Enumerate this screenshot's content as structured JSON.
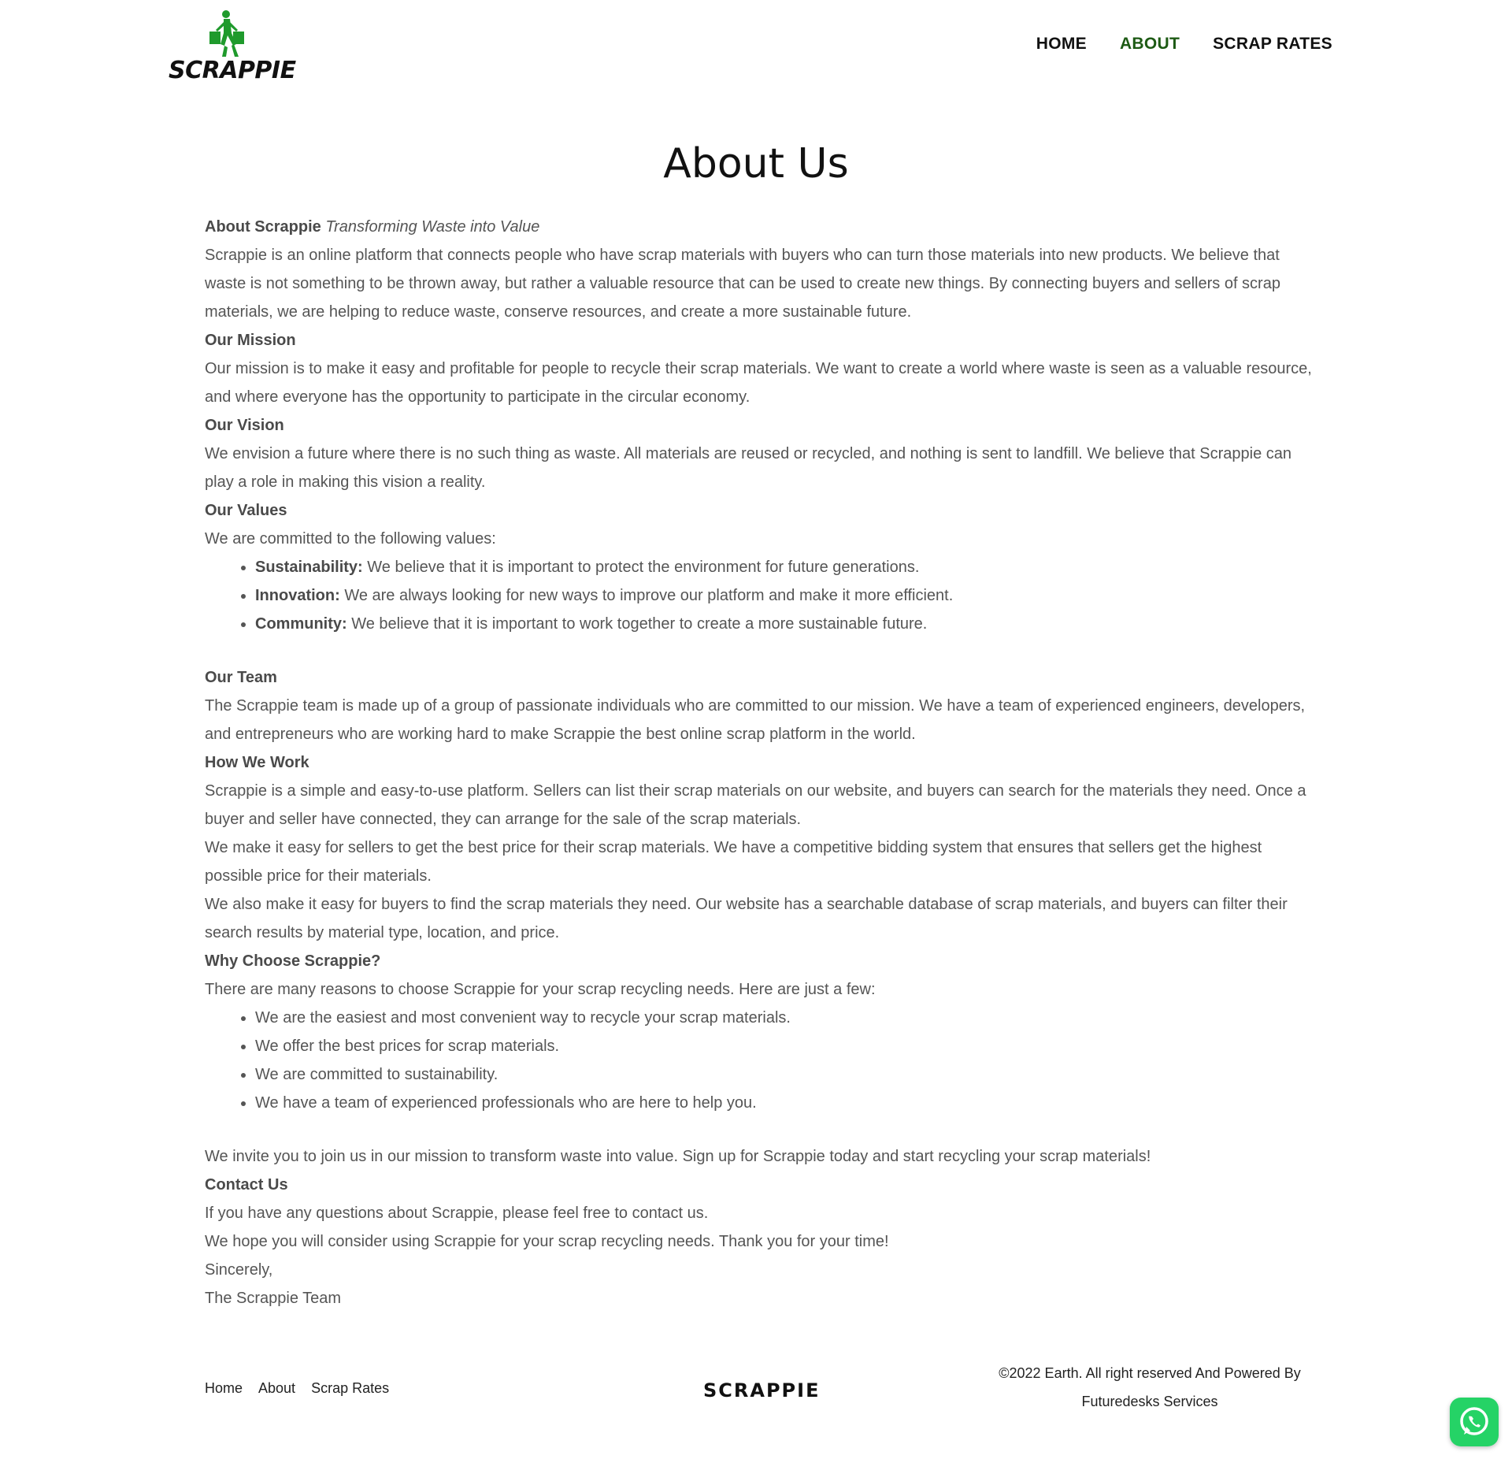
{
  "header": {
    "logo_text": "SCRAPPIE",
    "nav": [
      {
        "label": "HOME",
        "active": false
      },
      {
        "label": "ABOUT",
        "active": true
      },
      {
        "label": "SCRAP RATES",
        "active": false
      }
    ],
    "active_color": "#1d5a14"
  },
  "page": {
    "title": "About Us"
  },
  "content": {
    "intro_heading": "About Scrappie",
    "intro_tagline": "Transforming Waste into Value",
    "intro_text": "Scrappie is an online platform that connects people who have scrap materials with buyers who can turn those materials into new products. We believe that waste is not something to be thrown away, but rather a valuable resource that can be used to create new things. By connecting buyers and sellers of scrap materials, we are helping to reduce waste, conserve resources, and create a more sustainable future.",
    "mission_heading": "Our Mission",
    "mission_text": "Our mission is to make it easy and profitable for people to recycle their scrap materials. We want to create a world where waste is seen as a valuable resource, and where everyone has the opportunity to participate in the circular economy.",
    "vision_heading": "Our Vision",
    "vision_text": "We envision a future where there is no such thing as waste. All materials are reused or recycled, and nothing is sent to landfill. We believe that Scrappie can play a role in making this vision a reality.",
    "values_heading": "Our Values",
    "values_intro": "We are committed to the following values:",
    "values": [
      {
        "term": "Sustainability:",
        "text": " We believe that it is important to protect the environment for future generations."
      },
      {
        "term": "Innovation:",
        "text": " We are always looking for new ways to improve our platform and make it more efficient."
      },
      {
        "term": "Community:",
        "text": " We believe that it is important to work together to create a more sustainable future."
      }
    ],
    "team_heading": "Our Team",
    "team_text": "The Scrappie team is made up of a group of passionate individuals who are committed to our mission. We have a team of experienced engineers, developers, and entrepreneurs who are working hard to make Scrappie the best online scrap platform in the world.",
    "how_heading": "How We Work",
    "how_text_1": "Scrappie is a simple and easy-to-use platform. Sellers can list their scrap materials on our website, and buyers can search for the materials they need. Once a buyer and seller have connected, they can arrange for the sale of the scrap materials.",
    "how_text_2": "We make it easy for sellers to get the best price for their scrap materials. We have a competitive bidding system that ensures that sellers get the highest possible price for their materials.",
    "how_text_3": "We also make it easy for buyers to find the scrap materials they need. Our website has a searchable database of scrap materials, and buyers can filter their search results by material type, location, and price.",
    "why_heading": "Why Choose Scrappie?",
    "why_intro": "There are many reasons to choose Scrappie for your scrap recycling needs. Here are just a few:",
    "why_items": [
      "We are the easiest and most convenient way to recycle your scrap materials.",
      "We offer the best prices for scrap materials.",
      "We are committed to sustainability.",
      "We have a team of experienced professionals who are here to help you."
    ],
    "invite_text": "We invite you to join us in our mission to transform waste into value. Sign up for Scrappie today and start recycling your scrap materials!",
    "contact_heading": "Contact Us",
    "contact_text": "If you have any questions about Scrappie, please feel free to contact us.",
    "closing_text": "We hope you will consider using Scrappie for your scrap recycling needs. Thank you for your time!",
    "signoff": "Sincerely,",
    "signature": "The Scrappie Team"
  },
  "footer": {
    "links": [
      "Home",
      "About",
      "Scrap Rates"
    ],
    "logo_text": "SCRAPPIE",
    "copyright_line1": "©2022 Earth. All right reserved And Powered By",
    "copyright_line2": "Futuredesks Services"
  },
  "floating": {
    "whatsapp_icon": "whatsapp-icon",
    "whatsapp_color": "#25d366"
  }
}
